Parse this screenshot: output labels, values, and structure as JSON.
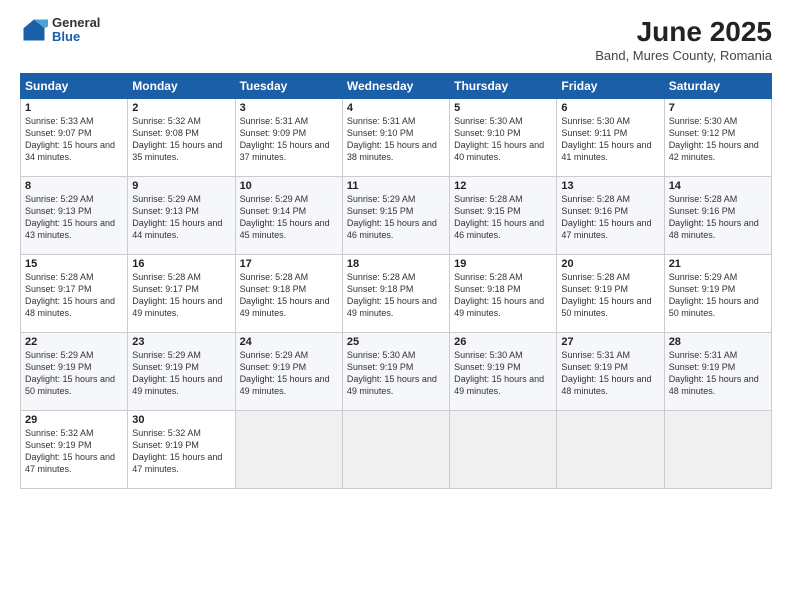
{
  "header": {
    "logo_general": "General",
    "logo_blue": "Blue",
    "title": "June 2025",
    "subtitle": "Band, Mures County, Romania"
  },
  "days_of_week": [
    "Sunday",
    "Monday",
    "Tuesday",
    "Wednesday",
    "Thursday",
    "Friday",
    "Saturday"
  ],
  "weeks": [
    [
      {
        "day": "1",
        "sunrise": "Sunrise: 5:33 AM",
        "sunset": "Sunset: 9:07 PM",
        "daylight": "Daylight: 15 hours and 34 minutes."
      },
      {
        "day": "2",
        "sunrise": "Sunrise: 5:32 AM",
        "sunset": "Sunset: 9:08 PM",
        "daylight": "Daylight: 15 hours and 35 minutes."
      },
      {
        "day": "3",
        "sunrise": "Sunrise: 5:31 AM",
        "sunset": "Sunset: 9:09 PM",
        "daylight": "Daylight: 15 hours and 37 minutes."
      },
      {
        "day": "4",
        "sunrise": "Sunrise: 5:31 AM",
        "sunset": "Sunset: 9:10 PM",
        "daylight": "Daylight: 15 hours and 38 minutes."
      },
      {
        "day": "5",
        "sunrise": "Sunrise: 5:30 AM",
        "sunset": "Sunset: 9:10 PM",
        "daylight": "Daylight: 15 hours and 40 minutes."
      },
      {
        "day": "6",
        "sunrise": "Sunrise: 5:30 AM",
        "sunset": "Sunset: 9:11 PM",
        "daylight": "Daylight: 15 hours and 41 minutes."
      },
      {
        "day": "7",
        "sunrise": "Sunrise: 5:30 AM",
        "sunset": "Sunset: 9:12 PM",
        "daylight": "Daylight: 15 hours and 42 minutes."
      }
    ],
    [
      {
        "day": "8",
        "sunrise": "Sunrise: 5:29 AM",
        "sunset": "Sunset: 9:13 PM",
        "daylight": "Daylight: 15 hours and 43 minutes."
      },
      {
        "day": "9",
        "sunrise": "Sunrise: 5:29 AM",
        "sunset": "Sunset: 9:13 PM",
        "daylight": "Daylight: 15 hours and 44 minutes."
      },
      {
        "day": "10",
        "sunrise": "Sunrise: 5:29 AM",
        "sunset": "Sunset: 9:14 PM",
        "daylight": "Daylight: 15 hours and 45 minutes."
      },
      {
        "day": "11",
        "sunrise": "Sunrise: 5:29 AM",
        "sunset": "Sunset: 9:15 PM",
        "daylight": "Daylight: 15 hours and 46 minutes."
      },
      {
        "day": "12",
        "sunrise": "Sunrise: 5:28 AM",
        "sunset": "Sunset: 9:15 PM",
        "daylight": "Daylight: 15 hours and 46 minutes."
      },
      {
        "day": "13",
        "sunrise": "Sunrise: 5:28 AM",
        "sunset": "Sunset: 9:16 PM",
        "daylight": "Daylight: 15 hours and 47 minutes."
      },
      {
        "day": "14",
        "sunrise": "Sunrise: 5:28 AM",
        "sunset": "Sunset: 9:16 PM",
        "daylight": "Daylight: 15 hours and 48 minutes."
      }
    ],
    [
      {
        "day": "15",
        "sunrise": "Sunrise: 5:28 AM",
        "sunset": "Sunset: 9:17 PM",
        "daylight": "Daylight: 15 hours and 48 minutes."
      },
      {
        "day": "16",
        "sunrise": "Sunrise: 5:28 AM",
        "sunset": "Sunset: 9:17 PM",
        "daylight": "Daylight: 15 hours and 49 minutes."
      },
      {
        "day": "17",
        "sunrise": "Sunrise: 5:28 AM",
        "sunset": "Sunset: 9:18 PM",
        "daylight": "Daylight: 15 hours and 49 minutes."
      },
      {
        "day": "18",
        "sunrise": "Sunrise: 5:28 AM",
        "sunset": "Sunset: 9:18 PM",
        "daylight": "Daylight: 15 hours and 49 minutes."
      },
      {
        "day": "19",
        "sunrise": "Sunrise: 5:28 AM",
        "sunset": "Sunset: 9:18 PM",
        "daylight": "Daylight: 15 hours and 49 minutes."
      },
      {
        "day": "20",
        "sunrise": "Sunrise: 5:28 AM",
        "sunset": "Sunset: 9:19 PM",
        "daylight": "Daylight: 15 hours and 50 minutes."
      },
      {
        "day": "21",
        "sunrise": "Sunrise: 5:29 AM",
        "sunset": "Sunset: 9:19 PM",
        "daylight": "Daylight: 15 hours and 50 minutes."
      }
    ],
    [
      {
        "day": "22",
        "sunrise": "Sunrise: 5:29 AM",
        "sunset": "Sunset: 9:19 PM",
        "daylight": "Daylight: 15 hours and 50 minutes."
      },
      {
        "day": "23",
        "sunrise": "Sunrise: 5:29 AM",
        "sunset": "Sunset: 9:19 PM",
        "daylight": "Daylight: 15 hours and 49 minutes."
      },
      {
        "day": "24",
        "sunrise": "Sunrise: 5:29 AM",
        "sunset": "Sunset: 9:19 PM",
        "daylight": "Daylight: 15 hours and 49 minutes."
      },
      {
        "day": "25",
        "sunrise": "Sunrise: 5:30 AM",
        "sunset": "Sunset: 9:19 PM",
        "daylight": "Daylight: 15 hours and 49 minutes."
      },
      {
        "day": "26",
        "sunrise": "Sunrise: 5:30 AM",
        "sunset": "Sunset: 9:19 PM",
        "daylight": "Daylight: 15 hours and 49 minutes."
      },
      {
        "day": "27",
        "sunrise": "Sunrise: 5:31 AM",
        "sunset": "Sunset: 9:19 PM",
        "daylight": "Daylight: 15 hours and 48 minutes."
      },
      {
        "day": "28",
        "sunrise": "Sunrise: 5:31 AM",
        "sunset": "Sunset: 9:19 PM",
        "daylight": "Daylight: 15 hours and 48 minutes."
      }
    ],
    [
      {
        "day": "29",
        "sunrise": "Sunrise: 5:32 AM",
        "sunset": "Sunset: 9:19 PM",
        "daylight": "Daylight: 15 hours and 47 minutes."
      },
      {
        "day": "30",
        "sunrise": "Sunrise: 5:32 AM",
        "sunset": "Sunset: 9:19 PM",
        "daylight": "Daylight: 15 hours and 47 minutes."
      },
      {
        "day": "",
        "sunrise": "",
        "sunset": "",
        "daylight": ""
      },
      {
        "day": "",
        "sunrise": "",
        "sunset": "",
        "daylight": ""
      },
      {
        "day": "",
        "sunrise": "",
        "sunset": "",
        "daylight": ""
      },
      {
        "day": "",
        "sunrise": "",
        "sunset": "",
        "daylight": ""
      },
      {
        "day": "",
        "sunrise": "",
        "sunset": "",
        "daylight": ""
      }
    ]
  ]
}
